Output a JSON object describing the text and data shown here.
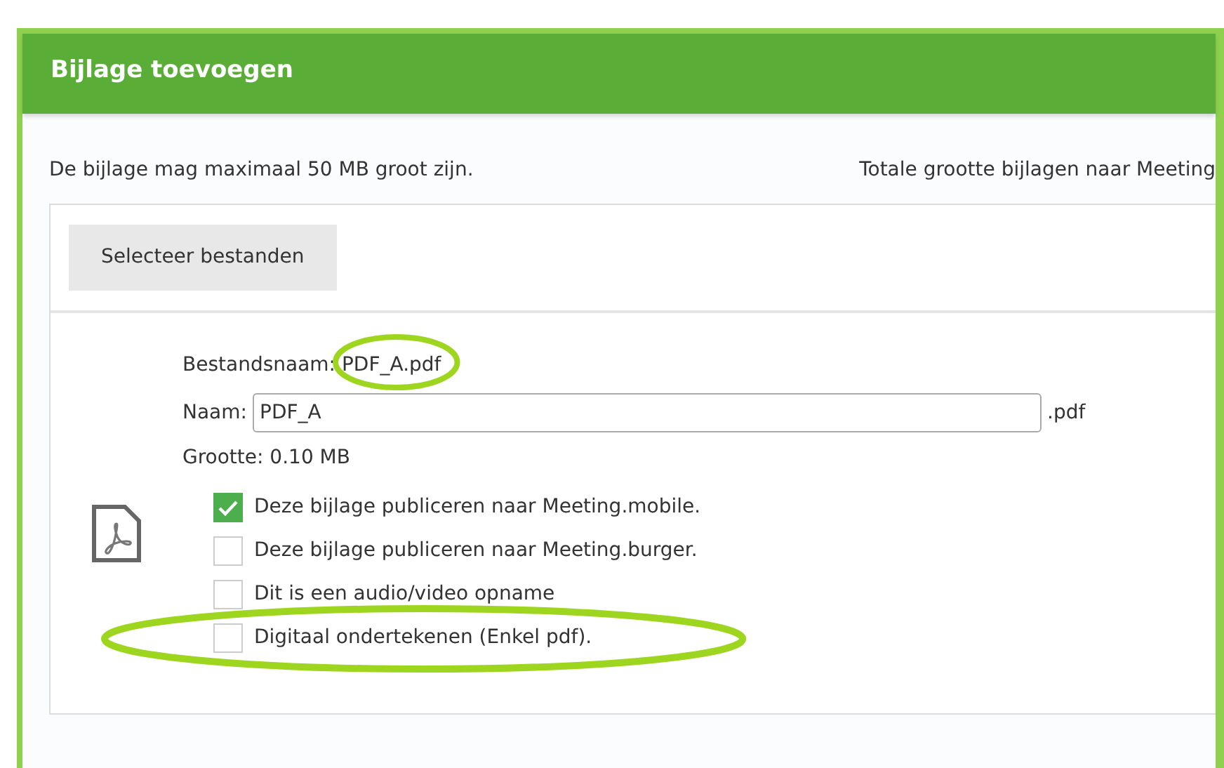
{
  "dialog": {
    "title": "Bijlage toevoegen"
  },
  "info": {
    "max_size": "De bijlage mag maximaal 50 MB groot zijn.",
    "total_size": "Totale grootte bijlagen naar Meeting"
  },
  "select_button": "Selecteer bestanden",
  "file": {
    "filename": "Bestandsnaam: PDF_A.pdf",
    "name_label": "Naam:",
    "name_value": "PDF_A",
    "extension": ".pdf",
    "size": "Grootte: 0.10 MB",
    "options": [
      {
        "label": "Deze bijlage publiceren naar Meeting.mobile.",
        "checked": true
      },
      {
        "label": "Deze bijlage publiceren naar Meeting.burger.",
        "checked": false
      },
      {
        "label": "Dit is een audio/video opname",
        "checked": false
      },
      {
        "label": "Digitaal ondertekenen (Enkel pdf).",
        "checked": false
      }
    ]
  }
}
